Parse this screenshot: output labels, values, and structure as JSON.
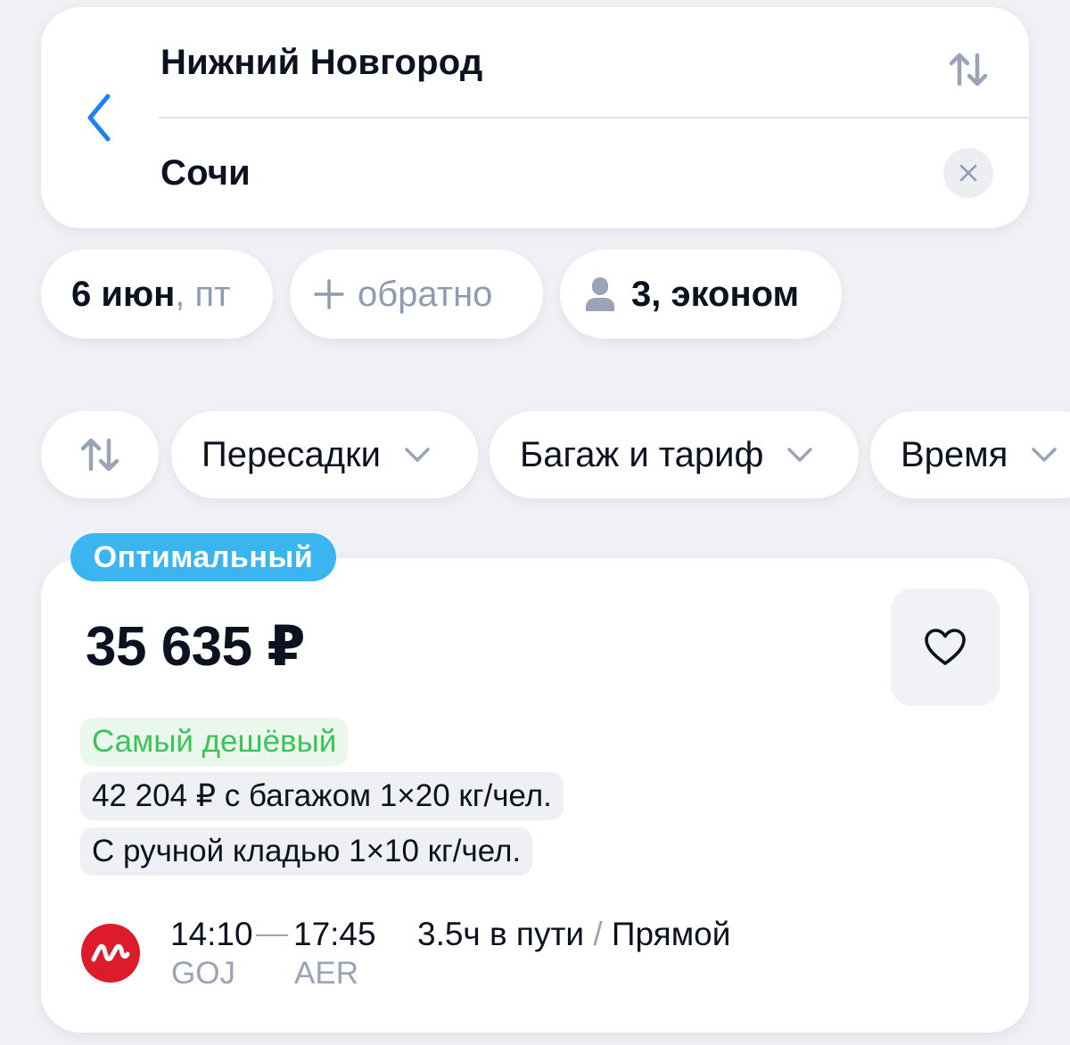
{
  "search": {
    "from": "Нижний Новгород",
    "to": "Сочи"
  },
  "params": {
    "date_main": "6 июн",
    "date_weekday": ", пт",
    "return_label": "обратно",
    "passengers_label": "3, эконом"
  },
  "filters": {
    "transfers": "Пересадки",
    "baggage": "Багаж и тариф",
    "time": "Время"
  },
  "offer": {
    "badge": "Оптимальный",
    "price": "35 635 ₽",
    "tags": {
      "cheapest": "Самый дешёвый",
      "baggage": "42 204 ₽ с багажом 1×20 кг/чел.",
      "hand_luggage": "С ручной кладью 1×10 кг/чел."
    },
    "flight": {
      "departure_time": "14:10",
      "arrival_time": "17:45",
      "departure_code": "GOJ",
      "arrival_code": "AER",
      "duration": "3.5ч в пути",
      "separator": "/",
      "type": "Прямой"
    }
  },
  "icons": {
    "back": "chevron-left-icon",
    "swap": "swap-arrows-icon",
    "clear": "close-icon",
    "add": "plus-icon",
    "passenger": "person-icon",
    "sort": "sort-arrows-icon",
    "dropdown": "chevron-down-icon",
    "favorite": "heart-icon",
    "airline": "airline-logo-icon"
  },
  "colors": {
    "accent_blue": "#1a82f5",
    "badge_blue": "#3bb5f0",
    "cheapest_green": "#3ec35a",
    "airline_red": "#dd1b2b",
    "muted_text": "#8f9bb0",
    "background": "#eff1f5"
  }
}
